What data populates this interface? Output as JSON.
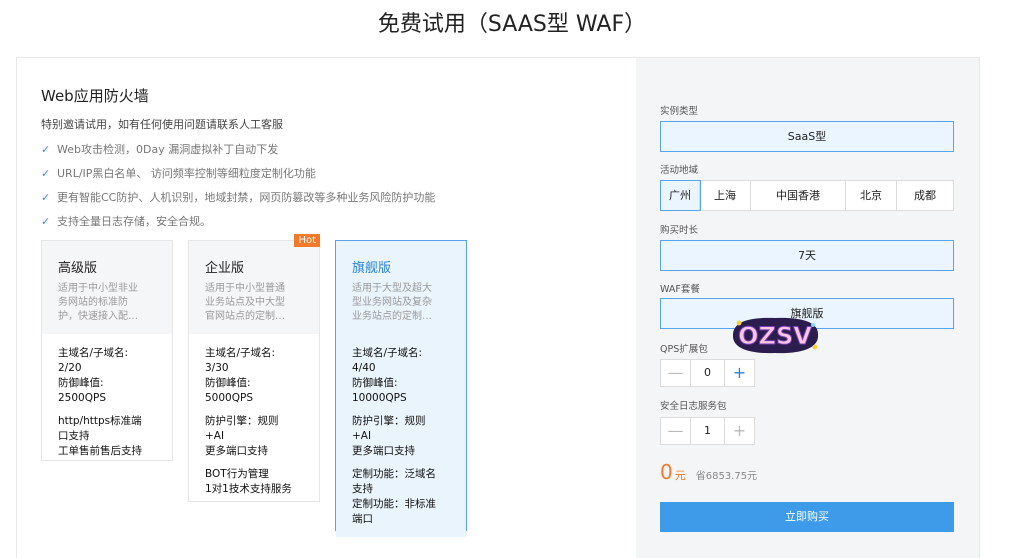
{
  "page": {
    "title": "免费试用（SAAS型 WAF）"
  },
  "product": {
    "name": "Web应用防火墙",
    "invite": "特别邀请试用，如有任何使用问题请联系人工客服",
    "features": [
      "Web攻击检测，0Day 漏洞虚拟补丁自动下发",
      "URL/IP黑白名单、 访问频率控制等细粒度定制化功能",
      "更有智能CC防护、人机识别，地域封禁，网页防篡改等多种业务风险防护功能",
      "支持全量日志存储，安全合规。"
    ]
  },
  "plans": [
    {
      "name": "高级版",
      "desc": [
        "适用于中小型非业",
        "务网站的标准防",
        "护，快速接入配…"
      ],
      "details": [
        [
          "主域名/子域名:",
          "2/20"
        ],
        [
          "防御峰值:",
          "2500QPS"
        ],
        [
          "http/https标准端",
          "口支持"
        ],
        [
          "工单售前售后支持"
        ]
      ]
    },
    {
      "name": "企业版",
      "hot": "Hot",
      "desc": [
        "适用于中小型普通",
        "业务站点及中大型",
        "官网站点的定制…"
      ],
      "details": [
        [
          "主域名/子域名:",
          "3/30"
        ],
        [
          "防御峰值:",
          "5000QPS"
        ],
        [
          "防护引擎：规则",
          "+AI"
        ],
        [
          "更多端口支持"
        ],
        [
          "BOT行为管理",
          "1对1技术支持服务"
        ]
      ]
    },
    {
      "name": "旗舰版",
      "desc": [
        "适用于大型及超大",
        "型业务网站及复杂",
        "业务站点的定制…"
      ],
      "details": [
        [
          "主域名/子域名:",
          "4/40"
        ],
        [
          "防御峰值:",
          "10000QPS"
        ],
        [
          "防护引擎：规则",
          "+AI"
        ],
        [
          "更多端口支持"
        ],
        [
          "定制功能：泛域名",
          "支持"
        ],
        [
          "定制功能：非标准",
          "端口"
        ]
      ]
    }
  ],
  "order": {
    "instance_type_label": "实例类型",
    "instance_type_value": "SaaS型",
    "region_label": "活动地域",
    "regions": [
      "广州",
      "上海",
      "中国香港",
      "北京",
      "成都"
    ],
    "selected_region": "广州",
    "duration_label": "购买时长",
    "duration_value": "7天",
    "package_label": "WAF套餐",
    "package_value": "旗舰版",
    "qps_label": "QPS扩展包",
    "qps_value": "0",
    "log_label": "安全日志服务包",
    "log_value": "1",
    "minus": "—",
    "plus": "+",
    "price": "0",
    "price_unit": "元",
    "savings": "省6853.75元",
    "buy_label": "立即购买"
  },
  "sticker": {
    "text": "OZSV"
  },
  "colors": {
    "accent": "#3d9be9",
    "price": "#f47a2a",
    "hot": "#f47a2a",
    "selected_bg": "#eaf5ff"
  }
}
